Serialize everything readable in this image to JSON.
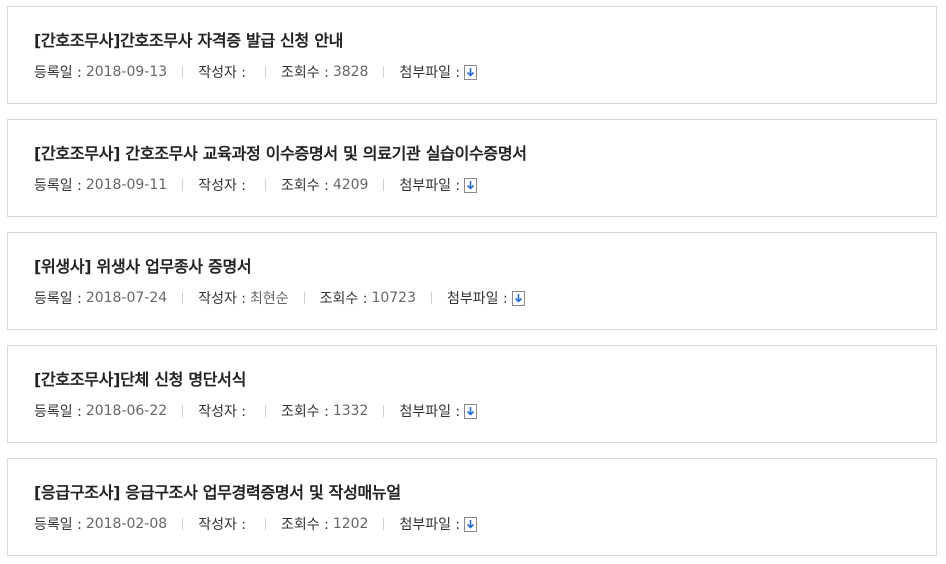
{
  "labels": {
    "date": "등록일 :",
    "author": "작성자 :",
    "views": "조회수 :",
    "attachment": "첨부파일 :"
  },
  "colors": {
    "border": "#d9d9d9",
    "icon_arrow": "#2a6fd6"
  },
  "posts": [
    {
      "title": "[간호조무사]간호조무사 자격증 발급 신청 안내",
      "date": "2018-09-13",
      "author": "",
      "views": "3828",
      "attachment_icon": "download-file-icon"
    },
    {
      "title": "[간호조무사] 간호조무사 교육과정 이수증명서 및 의료기관 실습이수증명서",
      "date": "2018-09-11",
      "author": "",
      "views": "4209",
      "attachment_icon": "download-file-icon"
    },
    {
      "title": "[위생사] 위생사 업무종사 증명서",
      "date": "2018-07-24",
      "author": "최현순",
      "views": "10723",
      "attachment_icon": "download-file-icon"
    },
    {
      "title": "[간호조무사]단체 신청 명단서식",
      "date": "2018-06-22",
      "author": "",
      "views": "1332",
      "attachment_icon": "download-file-icon"
    },
    {
      "title": "[응급구조사] 응급구조사 업무경력증명서 및 작성매뉴얼",
      "date": "2018-02-08",
      "author": "",
      "views": "1202",
      "attachment_icon": "download-file-icon"
    }
  ]
}
